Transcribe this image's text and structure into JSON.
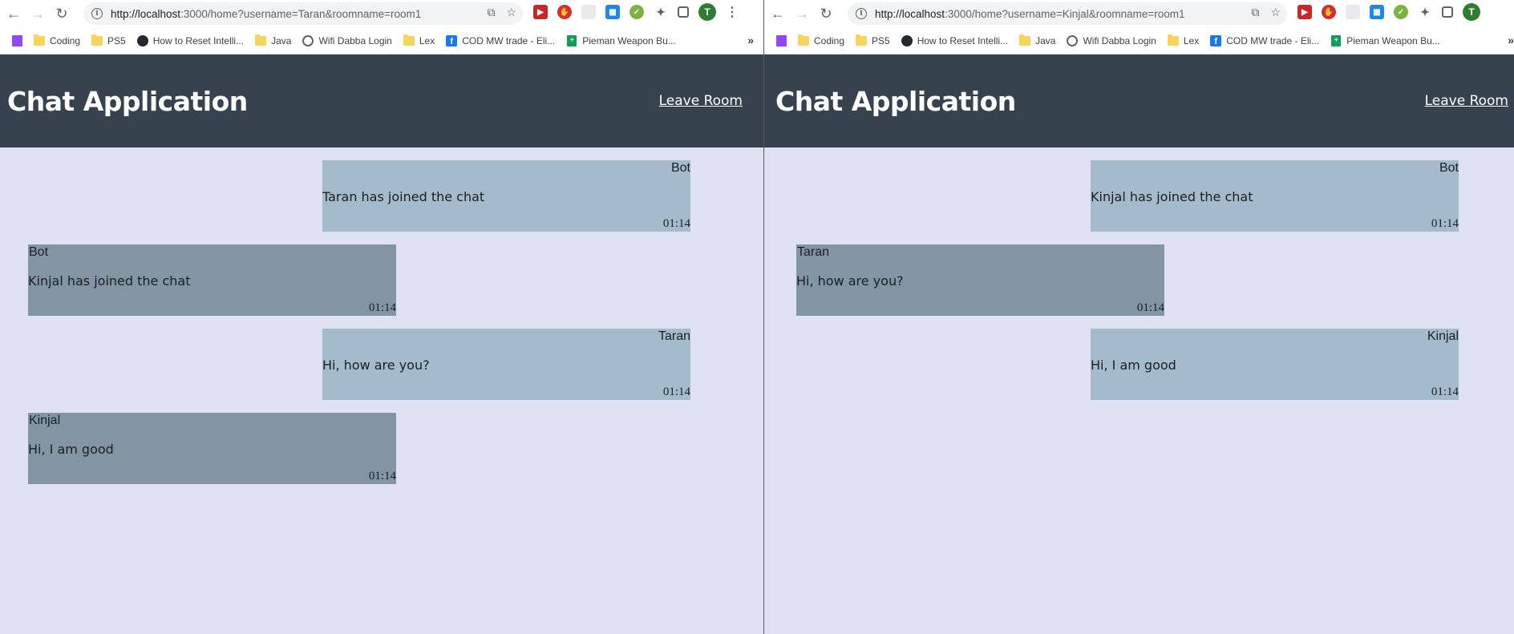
{
  "windows": [
    {
      "url_host": "http://localhost",
      "url_path": ":3000/home?username=Taran&roomname=room1",
      "app_title": "Chat Application",
      "leave_label": "Leave Room",
      "messages": [
        {
          "sender": "Bot",
          "text": "Taran has joined the chat",
          "time": "01:14",
          "side": "self"
        },
        {
          "sender": "Bot",
          "text": "Kinjal has joined the chat",
          "time": "01:14",
          "side": "other"
        },
        {
          "sender": "Taran",
          "text": "Hi, how are you?",
          "time": "01:14",
          "side": "self"
        },
        {
          "sender": "Kinjal",
          "text": "Hi, I am good",
          "time": "01:14",
          "side": "other"
        }
      ]
    },
    {
      "url_host": "http://localhost",
      "url_path": ":3000/home?username=Kinjal&roomname=room1",
      "app_title": "Chat Application",
      "leave_label": "Leave Room",
      "messages": [
        {
          "sender": "Bot",
          "text": "Kinjal has joined the chat",
          "time": "01:14",
          "side": "self"
        },
        {
          "sender": "Taran",
          "text": "Hi, how are you?",
          "time": "01:14",
          "side": "other"
        },
        {
          "sender": "Kinjal",
          "text": "Hi, I am good",
          "time": "01:14",
          "side": "self"
        }
      ]
    }
  ],
  "bookmarks": [
    {
      "icon": "twitch-icon",
      "label": ""
    },
    {
      "icon": "folder-icon",
      "label": "Coding"
    },
    {
      "icon": "folder-icon",
      "label": "PS5"
    },
    {
      "icon": "github-icon",
      "label": "How to Reset Intelli..."
    },
    {
      "icon": "folder-icon",
      "label": "Java"
    },
    {
      "icon": "globe-icon",
      "label": "Wifi Dabba Login"
    },
    {
      "icon": "folder-icon",
      "label": "Lex"
    },
    {
      "icon": "facebook-icon",
      "label": "COD MW trade - Eli..."
    },
    {
      "icon": "sheets-icon",
      "label": "Pieman Weapon Bu..."
    }
  ],
  "profile_initial": "T",
  "colors": {
    "header_bg": "#36424e",
    "page_bg": "#dfe2f3",
    "self_bubble": "#a4bbcb",
    "other_bubble": "#8395a3"
  }
}
